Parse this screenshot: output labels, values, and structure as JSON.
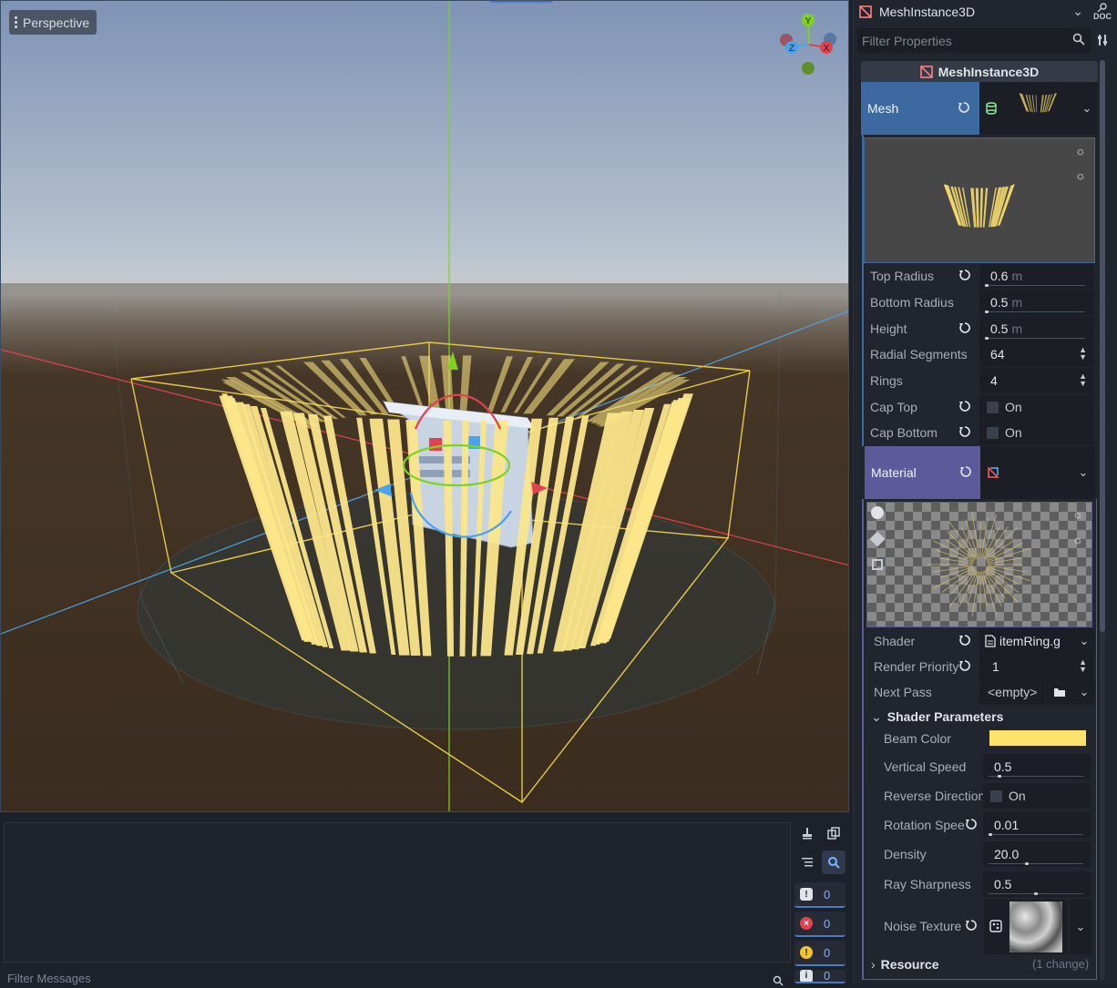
{
  "viewport": {
    "mode_label": "Perspective",
    "gizmo_axes": [
      "Y",
      "Z",
      "X"
    ]
  },
  "output": {
    "filter_placeholder": "Filter Messages",
    "counts": {
      "messages": "0",
      "errors": "0",
      "warnings": "0",
      "info": "0"
    }
  },
  "inspector": {
    "node_name": "MeshInstance3D",
    "filter_placeholder": "Filter Properties",
    "class_header": "MeshInstance3D",
    "mesh": {
      "label": "Mesh",
      "properties": [
        {
          "label": "Top Radius",
          "value": "0.6",
          "unit": "m",
          "fraction": 0.0
        },
        {
          "label": "Bottom Radius",
          "value": "0.5",
          "unit": "m",
          "fraction": 0.0
        },
        {
          "label": "Height",
          "value": "0.5",
          "unit": "m",
          "fraction": 0.0
        },
        {
          "label": "Radial Segments",
          "value": "64"
        },
        {
          "label": "Rings",
          "value": "4"
        },
        {
          "label": "Cap Top",
          "check_label": "On"
        },
        {
          "label": "Cap Bottom",
          "check_label": "On"
        }
      ]
    },
    "material": {
      "label": "Material",
      "shader_label": "Shader",
      "shader_value": "itemRing.g",
      "render_priority_label": "Render Priority",
      "render_priority_value": "1",
      "next_pass_label": "Next Pass",
      "next_pass_value": "<empty>",
      "shader_params_header": "Shader Parameters",
      "beam_color_label": "Beam Color",
      "beam_color": "#ffe26b",
      "vertical_speed_label": "Vertical Speed",
      "vertical_speed": "0.5",
      "reverse_direction_label": "Reverse Direction",
      "reverse_direction_check": "On",
      "rotation_speed_label": "Rotation Spee",
      "rotation_speed": "0.01",
      "density_label": "Density",
      "density": "20.0",
      "ray_sharpness_label": "Ray Sharpness",
      "ray_sharpness": "0.5",
      "noise_texture_label": "Noise Texture",
      "resource_header": "Resource",
      "change_count": "(1 change)"
    }
  },
  "colors": {
    "accent": "#4a7ac0",
    "mesh_header": "#3c6aa0",
    "material_header": "#5c5a9a",
    "beam_yellow": "#ffe26b"
  }
}
